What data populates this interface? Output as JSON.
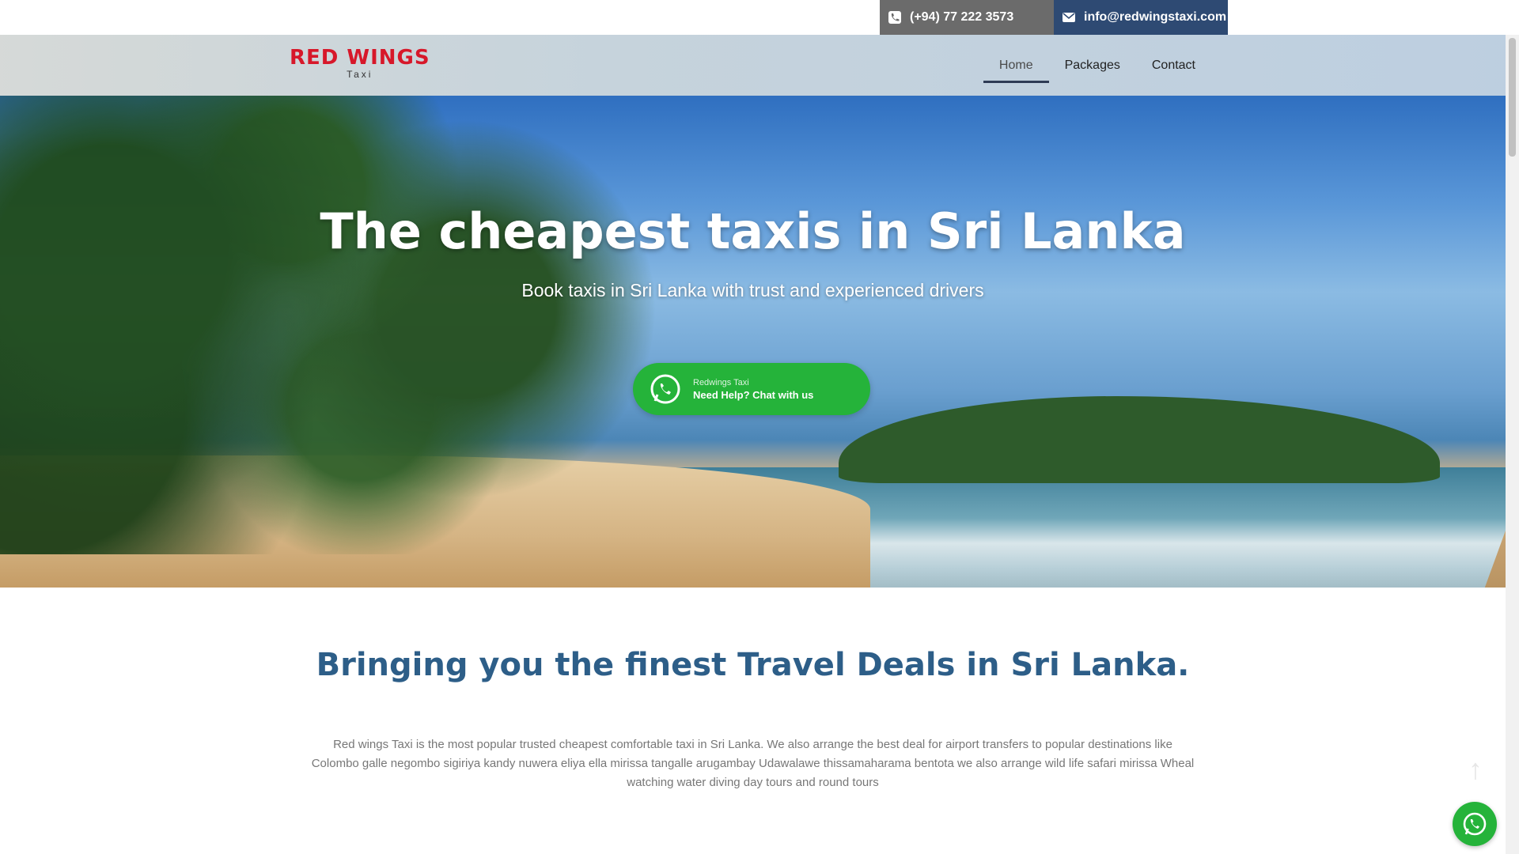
{
  "topbar": {
    "phone": "(+94) 77 222 3573",
    "email": "info@redwingstaxi.com",
    "phone_icon": "phone-icon",
    "email_icon": "mail-icon"
  },
  "header": {
    "logo_title": "RED WINGS",
    "logo_sub": "Taxi",
    "nav": [
      {
        "label": "Home",
        "active": true
      },
      {
        "label": "Packages",
        "active": false
      },
      {
        "label": "Contact",
        "active": false
      }
    ]
  },
  "hero": {
    "title": "The cheapest taxis in Sri Lanka",
    "subtitle": "Book taxis in Sri Lanka with trust and experienced drivers",
    "chat_line1": "Redwings Taxi",
    "chat_line2": "Need Help? Chat with us",
    "chat_icon": "whatsapp-icon"
  },
  "main": {
    "heading": "Bringing you the finest Travel Deals in Sri Lanka.",
    "paragraph": "Red wings Taxi is the most popular trusted cheapest comfortable taxi in Sri Lanka. We also arrange the best deal for airport transfers to popular destinations like Colombo galle negombo sigiriya kandy nuwera eliya ella mirissa tangalle arugambay Udawalawe thissamaharama bentota we also arrange wild life safari mirissa Wheal watching water diving day tours and round tours"
  },
  "colors": {
    "brand_red": "#d7182a",
    "heading_blue": "#2d5e88",
    "whatsapp_green": "#25b33a",
    "email_bg": "#2e4a73"
  }
}
